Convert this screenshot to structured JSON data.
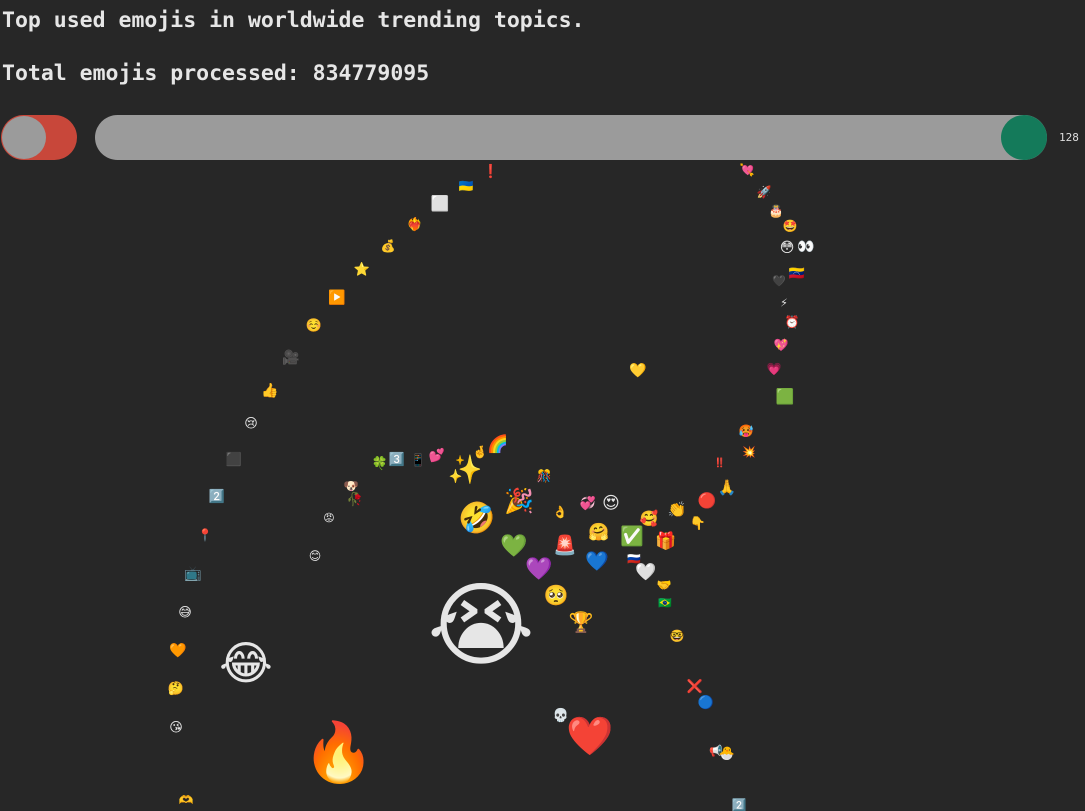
{
  "header": {
    "title": "Top used emojis in worldwide trending topics.",
    "total_label": "Total emojis processed: 834779095"
  },
  "controls": {
    "toggle": {
      "state": "on",
      "knob_color": "#9b9b9b",
      "track_color": "#c8473a"
    },
    "slider": {
      "value": "128",
      "track_color": "#9b9b9b",
      "thumb_color": "#147a5a"
    }
  },
  "emojis": [
    "😭",
    "😂",
    "🔥",
    "❤️",
    "🤣",
    "✨",
    "🎉",
    "💚",
    "💜",
    "🥺",
    "🏆",
    "💙",
    "🚨",
    "🤗",
    "✅",
    "🎁",
    "😍",
    "🥰",
    "👏",
    "🔴",
    "🙏",
    "👇",
    "🤍",
    "🤝",
    "🇧🇷",
    "🤓",
    "❌",
    "🔵",
    "📢",
    "💀",
    "💕",
    "🌈",
    "3️⃣",
    "🍀",
    "🥀",
    "🐶",
    "🇷🇺",
    "😡",
    "😊",
    "🤩",
    "💖",
    "💗",
    "💘",
    "💞",
    "🥵",
    "‼️",
    "🟩",
    "💛",
    "💥",
    "🤔",
    "😘",
    "🎊",
    "🫶",
    "🧡",
    "😅",
    "📺",
    "📍",
    "2️⃣",
    "⬛",
    "😢",
    "👍",
    "🎥",
    "☺️",
    "▶️",
    "⭐",
    "💰",
    "❤️‍🔥",
    "⬜",
    "🇺🇦",
    "❗",
    "🚀",
    "🎂",
    "😳",
    "👀",
    "🖤",
    "🇻🇪",
    "⚡",
    "⏰",
    "2️⃣",
    "📱",
    "🐣",
    "👌",
    "🤞"
  ]
}
